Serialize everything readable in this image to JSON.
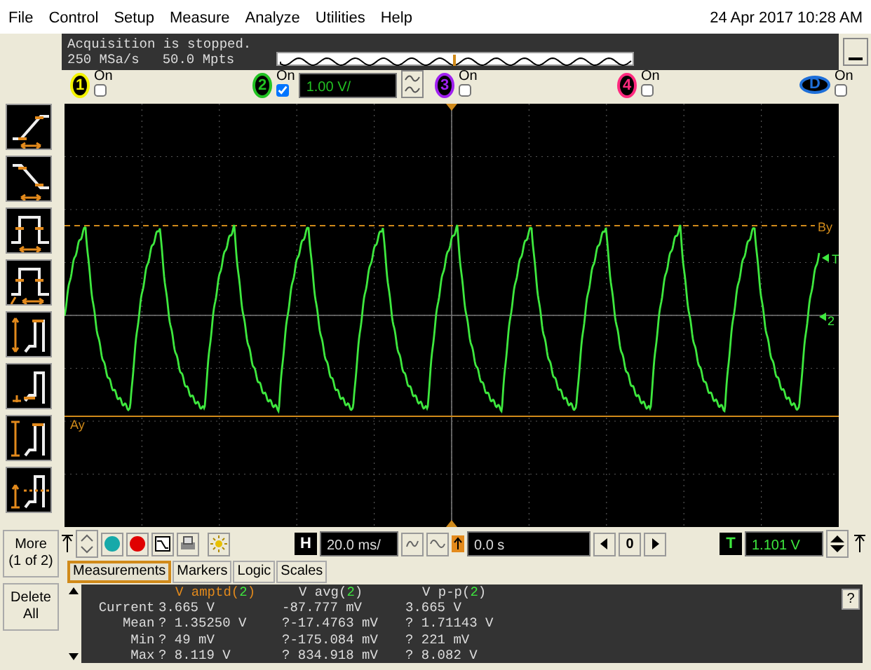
{
  "menu": {
    "items": [
      "File",
      "Control",
      "Setup",
      "Measure",
      "Analyze",
      "Utilities",
      "Help"
    ],
    "datetime": "24 Apr 2017 10:28 AM"
  },
  "acquisition": {
    "status": "Acquisition is stopped.",
    "sample_rate": "250 MSa/s",
    "memory_depth": "50.0 Mpts"
  },
  "channels": [
    {
      "label": "1",
      "color": "#f2f200",
      "on_label": "On",
      "on": false
    },
    {
      "label": "2",
      "color": "#22c222",
      "on_label": "On",
      "on": true,
      "scale": "1.00 V/"
    },
    {
      "label": "3",
      "color": "#a020f0",
      "on_label": "On",
      "on": false
    },
    {
      "label": "4",
      "color": "#ff2a7f",
      "on_label": "On",
      "on": false
    },
    {
      "label": "D",
      "color": "#1e6fd9",
      "on_label": "On",
      "on": false
    }
  ],
  "display": {
    "marker_b": "By",
    "marker_a": "Ay",
    "trigger_marker": "T",
    "channel_marker": "2"
  },
  "controls": {
    "horizontal_label": "H",
    "time_scale": "20.0 ms/",
    "position": "0.0 s",
    "delay": "0",
    "trigger_label": "T",
    "trigger_level": "1.101 V"
  },
  "side_buttons": [
    {
      "lines": [
        "More",
        "(1 of 2)"
      ]
    },
    {
      "lines": [
        "Delete",
        "All"
      ]
    }
  ],
  "tabs": [
    {
      "label": "Measurements",
      "selected": true
    },
    {
      "label": "Markers",
      "selected": false
    },
    {
      "label": "Logic",
      "selected": false
    },
    {
      "label": "Scales",
      "selected": false
    }
  ],
  "measurements": {
    "columns": [
      {
        "prefix": "V amptd(",
        "channel": "2",
        "suffix": ")",
        "selected": true
      },
      {
        "prefix": "V avg(",
        "channel": "2",
        "suffix": ")",
        "selected": false
      },
      {
        "prefix": "V p-p(",
        "channel": "2",
        "suffix": ")",
        "selected": false
      }
    ],
    "rows": [
      {
        "label": "Current",
        "values": [
          "3.665 V",
          "-87.777 mV",
          "3.665 V"
        ]
      },
      {
        "label": "Mean",
        "values": [
          "? 1.35250 V",
          "?-17.4763 mV",
          "? 1.71143 V"
        ]
      },
      {
        "label": "Min",
        "values": [
          "? 49 mV",
          "?-175.084 mV",
          "? 221 mV"
        ]
      },
      {
        "label": "Max",
        "values": [
          "? 8.119 V",
          "? 834.918 mV",
          "? 8.082 V"
        ]
      }
    ],
    "help": "?"
  }
}
